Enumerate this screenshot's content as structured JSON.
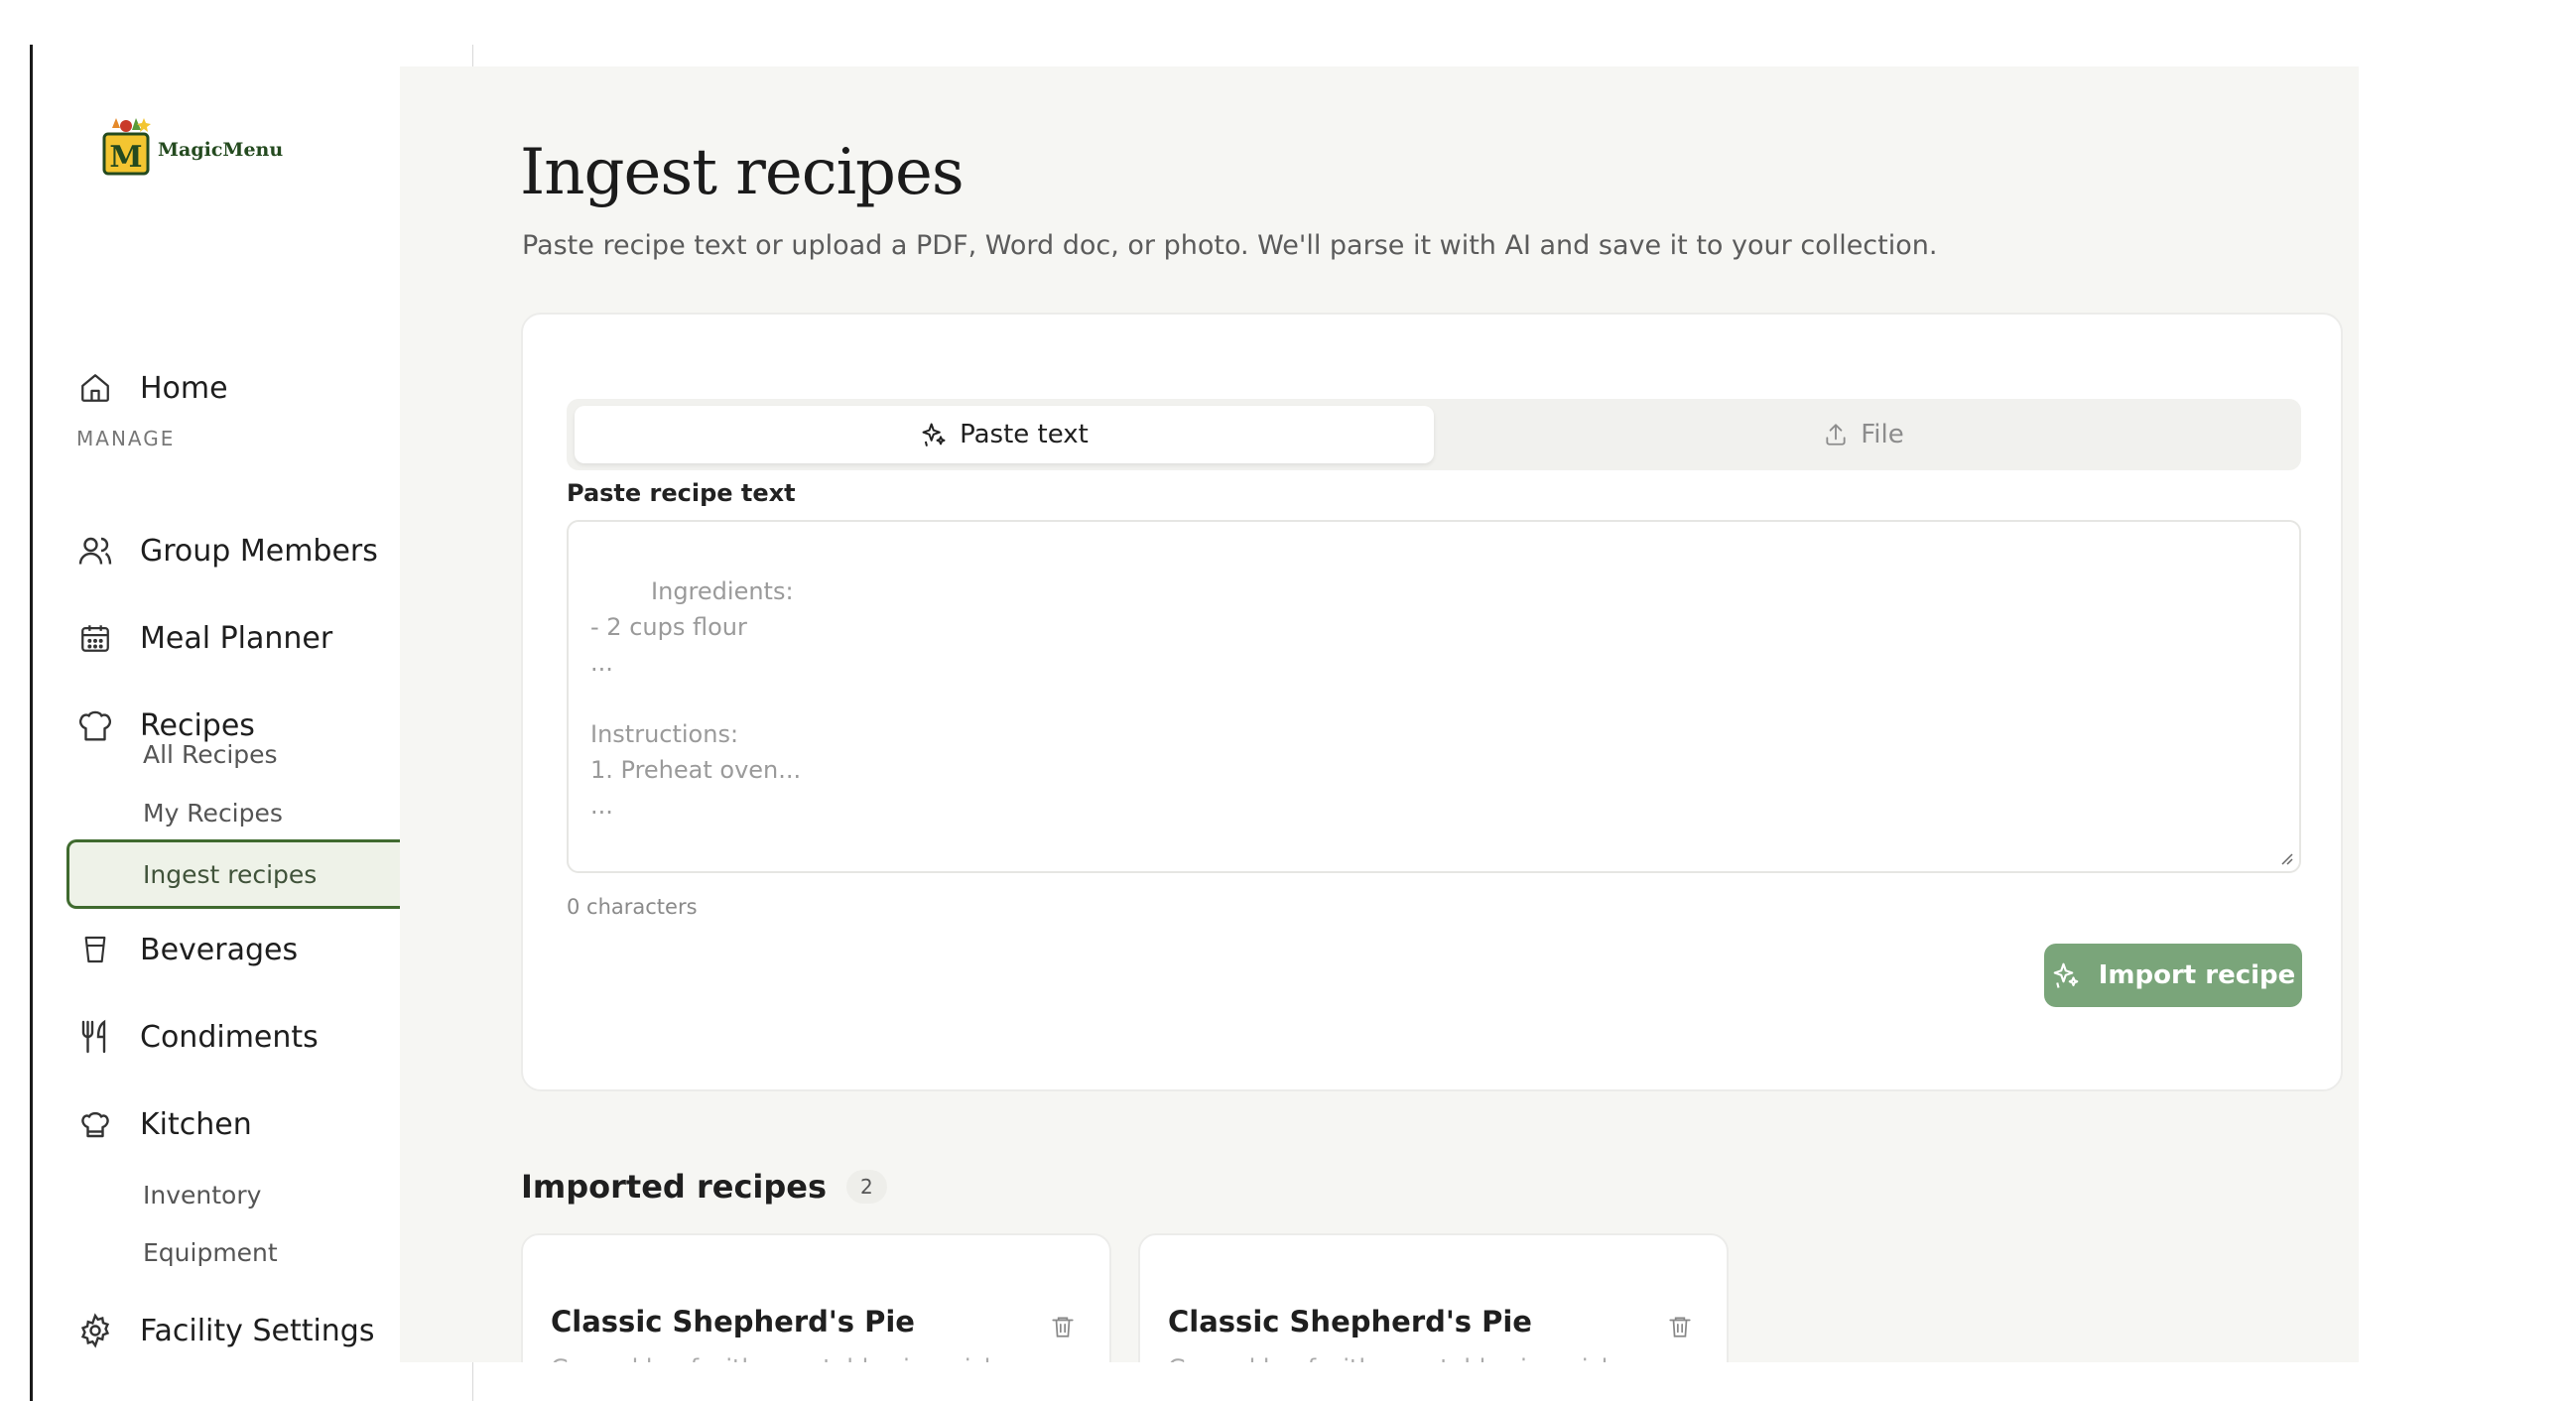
{
  "app": {
    "logo_text": "MagicMenu"
  },
  "sidebar": {
    "home": "Home",
    "section_label": "MANAGE",
    "items": [
      {
        "label": "Group Members",
        "icon": "users-icon"
      },
      {
        "label": "Meal Planner",
        "icon": "calendar-icon"
      },
      {
        "label": "Recipes",
        "icon": "chef-hat-icon"
      },
      {
        "label": "Beverages",
        "icon": "cup-icon"
      },
      {
        "label": "Condiments",
        "icon": "utensils-icon"
      },
      {
        "label": "Kitchen",
        "icon": "chef-hat-icon"
      },
      {
        "label": "Facility Settings",
        "icon": "gear-icon"
      }
    ],
    "recipes_sub": [
      "All Recipes",
      "My Recipes",
      "Ingest recipes"
    ],
    "kitchen_sub": [
      "Inventory",
      "Equipment"
    ]
  },
  "main": {
    "title": "Ingest recipes",
    "subtitle": "Paste recipe text or upload a PDF, Word doc, or photo. We'll parse it with AI and save it to your collection.",
    "tabs": {
      "paste": "Paste text",
      "file": "File"
    },
    "field_label": "Paste recipe text",
    "placeholder": "Ingredients:\n- 2 cups flour\n...\n\nInstructions:\n1. Preheat oven...\n...",
    "char_count": "0 characters",
    "import_button": "Import recipe",
    "imported_heading": "Imported recipes",
    "imported_count": "2",
    "recipes": [
      {
        "title": "Classic Shepherd's Pie",
        "desc": "Ground beef with vegetables in a rich"
      },
      {
        "title": "Classic Shepherd's Pie",
        "desc": "Ground beef with vegetables in a rich"
      }
    ]
  },
  "colors": {
    "accent": "#3f6a2e",
    "button": "#7aa57a",
    "background": "#f6f6f3"
  }
}
